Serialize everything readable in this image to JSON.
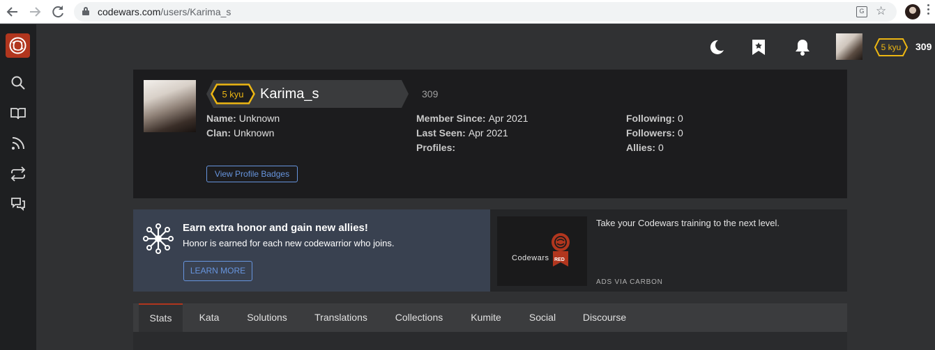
{
  "browser": {
    "url_host": "codewars.com",
    "url_path": "/users/Karima_s"
  },
  "topbar": {
    "rank": "5 kyu",
    "honor": "309"
  },
  "profile": {
    "rank": "5 kyu",
    "username": "Karima_s",
    "honor": "309",
    "name_label": "Name:",
    "name_value": "Unknown",
    "clan_label": "Clan:",
    "clan_value": "Unknown",
    "member_since_label": "Member Since:",
    "member_since_value": "Apr 2021",
    "last_seen_label": "Last Seen:",
    "last_seen_value": "Apr 2021",
    "profiles_label": "Profiles:",
    "following_label": "Following:",
    "following_value": "0",
    "followers_label": "Followers:",
    "followers_value": "0",
    "allies_label": "Allies:",
    "allies_value": "0",
    "badges_button": "View Profile Badges"
  },
  "promo": {
    "title": "Earn extra honor and gain new allies!",
    "subtitle": "Honor is earned for each new codewarrior who joins.",
    "button": "LEARN MORE"
  },
  "ad": {
    "brand": "Codewars",
    "tag": "RED",
    "text": "Take your Codewars training to the next level.",
    "via": "ADS VIA CARBON"
  },
  "tabs": [
    "Stats",
    "Kata",
    "Solutions",
    "Translations",
    "Collections",
    "Kumite",
    "Social",
    "Discourse"
  ],
  "colors": {
    "accent_red": "#b1361e",
    "rank_yellow": "#ecb613",
    "link_blue": "#6795de"
  }
}
